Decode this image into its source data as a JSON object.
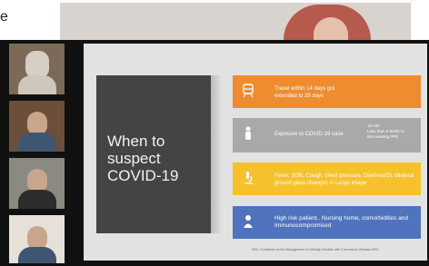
{
  "top_fragment": "e",
  "slide": {
    "title": "When to suspect COVID-19",
    "boxes": [
      {
        "text": "Travel within 14 days got extended to 28 days",
        "icon": "train-icon",
        "color": "#ee8c2f"
      },
      {
        "text": "Exposure to COVID-19 case",
        "icon": "person-icon",
        "color": "#a9a9a9",
        "side_lines": [
          "15 min",
          "Less than 6 feet/2 m",
          "Not wearing PPE"
        ]
      },
      {
        "text": "Fever, SOB, Cough, chest pressure, Diarrhea/GI, bilateral ground glass changes in Lungs image",
        "icon": "microscope-icon",
        "color": "#f6c12c"
      },
      {
        "text": "High risk patient.. Nursing home, comorbidities and Immunocompromised",
        "icon": "patient-icon",
        "color": "#4f73bd"
      }
    ],
    "footer": "SSC: Guidelines on the Management of Critically Ill Adults with Coronavirus Disease 2019"
  },
  "participants": [
    {
      "id": "participant-1"
    },
    {
      "id": "participant-2"
    },
    {
      "id": "participant-3"
    },
    {
      "id": "participant-4"
    }
  ]
}
